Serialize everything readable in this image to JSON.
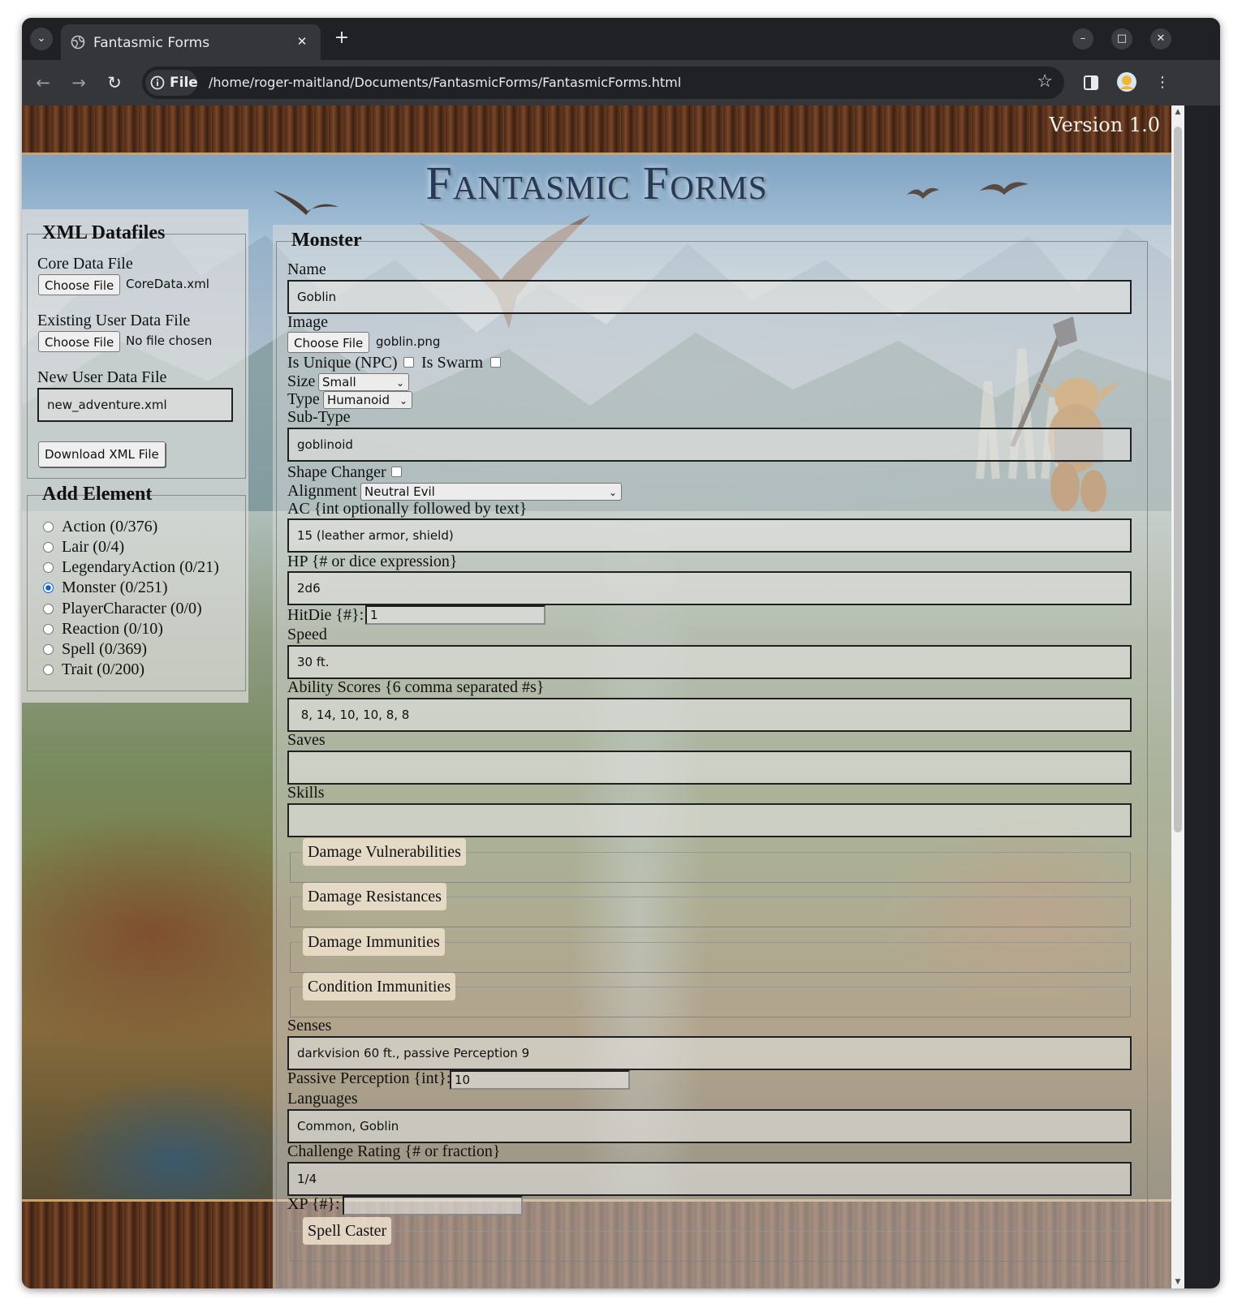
{
  "browser": {
    "tab_title": "Fantasmic Forms",
    "chip_label": "File",
    "url": "/home/roger-maitland/Documents/FantasmicForms/FantasmicForms.html"
  },
  "page": {
    "version": "Version 1.0",
    "title": "Fantasmic Forms"
  },
  "datafiles": {
    "legend": "XML Datafiles",
    "core_label": "Core Data File",
    "core_button": "Choose File",
    "core_file": "CoreData.xml",
    "existing_label": "Existing User Data File",
    "existing_button": "Choose File",
    "existing_file": "No file chosen",
    "new_label": "New User Data File",
    "new_value": "new_adventure.xml",
    "download_button": "Download XML File"
  },
  "add_element": {
    "legend": "Add Element",
    "options": [
      {
        "label": "Action (0/376)",
        "selected": false
      },
      {
        "label": "Lair (0/4)",
        "selected": false
      },
      {
        "label": "LegendaryAction (0/21)",
        "selected": false
      },
      {
        "label": "Monster (0/251)",
        "selected": true
      },
      {
        "label": "PlayerCharacter (0/0)",
        "selected": false
      },
      {
        "label": "Reaction (0/10)",
        "selected": false
      },
      {
        "label": "Spell (0/369)",
        "selected": false
      },
      {
        "label": "Trait (0/200)",
        "selected": false
      }
    ]
  },
  "monster": {
    "legend": "Monster",
    "name_label": "Name",
    "name_value": "Goblin",
    "image_label": "Image",
    "image_button": "Choose File",
    "image_file": "goblin.png",
    "unique_label": "Is Unique (NPC)",
    "swarm_label": "Is Swarm",
    "size_label": "Size",
    "size_value": "Small",
    "type_label": "Type",
    "type_value": "Humanoid",
    "subtype_label": "Sub-Type",
    "subtype_value": "goblinoid",
    "shape_label": "Shape Changer",
    "alignment_label": "Alignment",
    "alignment_value": "Neutral Evil",
    "ac_label": "AC {int optionally followed by text}",
    "ac_value": "15 (leather armor, shield)",
    "hp_label": "HP {# or dice expression}",
    "hp_value": "2d6",
    "hitdie_label": "HitDie {#}:",
    "hitdie_value": "1",
    "speed_label": "Speed",
    "speed_value": "30 ft.",
    "ability_label": "Ability Scores {6 comma separated #s}",
    "ability_value": " 8, 14, 10, 10, 8, 8",
    "saves_label": "Saves",
    "saves_value": "",
    "skills_label": "Skills",
    "skills_value": "",
    "vuln_label": "Damage Vulnerabilities",
    "resist_label": "Damage Resistances",
    "immune_label": "Damage Immunities",
    "condition_label": "Condition Immunities",
    "senses_label": "Senses",
    "senses_value": "darkvision 60 ft., passive Perception 9",
    "passive_label": "Passive Perception {int}:",
    "passive_value": "10",
    "languages_label": "Languages",
    "languages_value": "Common, Goblin",
    "cr_label": "Challenge Rating {# or fraction}",
    "cr_value": "1/4",
    "xp_label": "XP {#}:",
    "xp_value": "",
    "spellcaster_label": "Spell Caster"
  },
  "colors": {
    "chrome_dark": "#202124",
    "chrome_mid": "#35363a",
    "title_blue": "#243a5a",
    "radio_blue": "#0b61d8"
  }
}
